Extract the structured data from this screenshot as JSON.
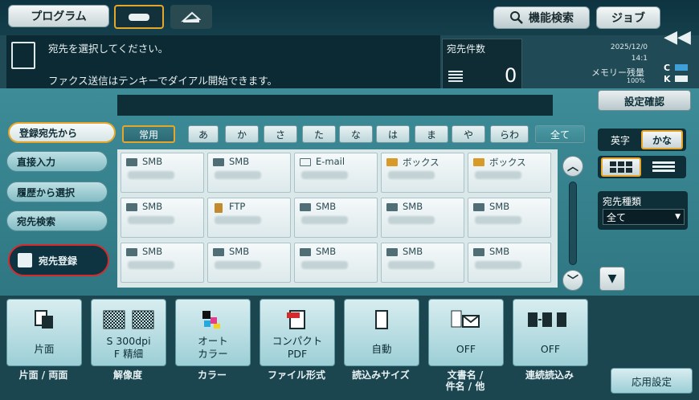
{
  "topbar": {
    "program": "プログラム",
    "function_search": "機能検索",
    "job": "ジョブ",
    "collapse": "◀◀"
  },
  "message": {
    "line1": "宛先を選択してください。",
    "line2": "ファクス送信はテンキーでダイアル開始できます。"
  },
  "counter": {
    "label": "宛先件数",
    "value": "0"
  },
  "status": {
    "date": "2025/12/0",
    "time": "14:1",
    "memory_label": "メモリー残量",
    "memory_pct": "100%",
    "toner": [
      "C",
      "K"
    ]
  },
  "settings_confirm": "設定確認",
  "left_nav": [
    {
      "label": "登録宛先から",
      "active": true
    },
    {
      "label": "直接入力",
      "active": false
    },
    {
      "label": "履歴から選択",
      "active": false
    },
    {
      "label": "宛先検索",
      "active": false
    }
  ],
  "register_button": "宛先登録",
  "index_tabs": [
    "常用",
    "あ",
    "か",
    "さ",
    "た",
    "な",
    "は",
    "ま",
    "や",
    "らわ",
    "全て"
  ],
  "grid": [
    [
      {
        "type": "SMB",
        "icon": "pc"
      },
      {
        "type": "SMB",
        "icon": "pc"
      },
      {
        "type": "E-mail",
        "icon": "mail"
      },
      {
        "type": "ボックス",
        "icon": "box"
      },
      {
        "type": "ボックス",
        "icon": "box"
      }
    ],
    [
      {
        "type": "SMB",
        "icon": "pc"
      },
      {
        "type": "FTP",
        "icon": "ftp"
      },
      {
        "type": "SMB",
        "icon": "pc"
      },
      {
        "type": "SMB",
        "icon": "pc"
      },
      {
        "type": "SMB",
        "icon": "pc"
      }
    ],
    [
      {
        "type": "SMB",
        "icon": "pc"
      },
      {
        "type": "SMB",
        "icon": "pc"
      },
      {
        "type": "SMB",
        "icon": "pc"
      },
      {
        "type": "SMB",
        "icon": "pc"
      },
      {
        "type": "SMB",
        "icon": "pc"
      }
    ]
  ],
  "right_panel": {
    "lang_en": "英字",
    "lang_kana": "かな",
    "type_label": "宛先種類",
    "type_value": "全て"
  },
  "functions": [
    {
      "icon": "simplex-icon",
      "lines": [
        "片面"
      ],
      "label": "片面 / 両面"
    },
    {
      "icon": "resolution-icon",
      "lines": [
        "S 300dpi",
        "F 精細"
      ],
      "label": "解像度"
    },
    {
      "icon": "color-icon",
      "lines": [
        "オート",
        "カラー"
      ],
      "label": "カラー"
    },
    {
      "icon": "pdf-icon",
      "lines": [
        "コンパクト",
        "PDF"
      ],
      "label": "ファイル形式"
    },
    {
      "icon": "page-size-icon",
      "lines": [
        "自動"
      ],
      "label": "読込みサイズ"
    },
    {
      "icon": "document-name-icon",
      "lines": [
        "OFF"
      ],
      "label": "文書名 /\n件名 / 他"
    },
    {
      "icon": "continuous-scan-icon",
      "lines": [
        "OFF"
      ],
      "label": "連続読込み"
    }
  ],
  "apply_settings": "応用設定",
  "colors": {
    "accent": "#e6a62a",
    "highlight": "#d6292b",
    "panel": "#3d8c98"
  }
}
